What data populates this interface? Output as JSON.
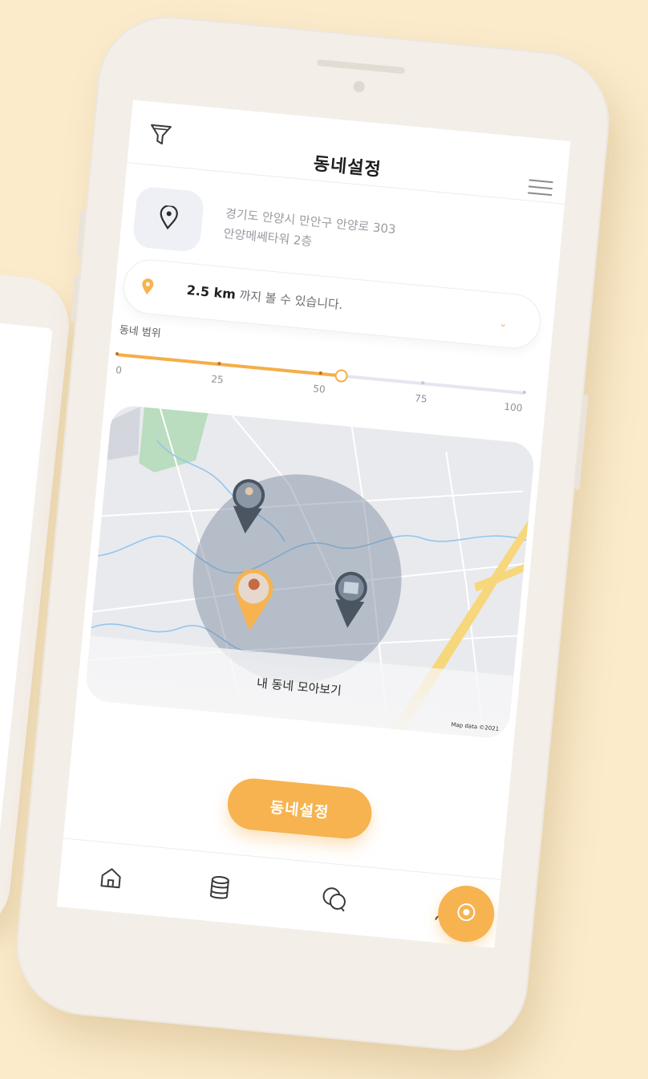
{
  "header": {
    "title": "동네설정",
    "filter_icon": "filter-icon",
    "menu_icon": "hamburger-menu-icon"
  },
  "location": {
    "icon": "location-pin-icon",
    "address_line1": "경기도 안양시 만안구 안양로 303",
    "address_line2": "안양메쎄타워 2층"
  },
  "range": {
    "icon": "map-pin-icon",
    "distance": "2.5 km",
    "suffix": " 까지 볼 수 있습니다.",
    "dropdown_icon": "chevron-down-icon"
  },
  "slider": {
    "label": "동네 범위",
    "ticks": [
      "0",
      "25",
      "50",
      "75",
      "100"
    ],
    "value_percent": 55
  },
  "map": {
    "caption": "내 동네 모아보기",
    "credit": "Map data ©2021"
  },
  "cta": {
    "label": "동네설정"
  },
  "fab": {
    "icon": "target-icon"
  },
  "nav": {
    "items": [
      {
        "name": "home",
        "icon": "home-icon"
      },
      {
        "name": "database",
        "icon": "database-icon"
      },
      {
        "name": "chat",
        "icon": "chat-bubbles-icon"
      },
      {
        "name": "profile",
        "icon": "user-icon"
      }
    ]
  },
  "colors": {
    "accent": "#F6B350",
    "background": "#FBEBCB",
    "muted_text": "#9B9BA3"
  }
}
